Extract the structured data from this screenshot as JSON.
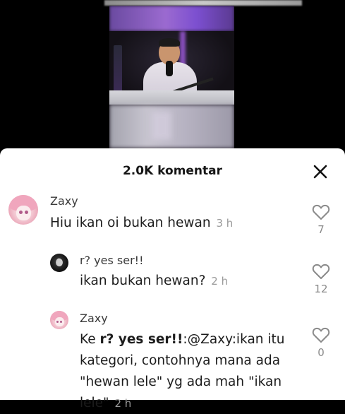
{
  "sheet": {
    "title": "2.0K komentar"
  },
  "comments": [
    {
      "username": "Zaxy",
      "avatar": "anime-girl-pink-hair",
      "text": "Hiu ikan oi bukan hewan",
      "time": "3 h",
      "likes": "7"
    },
    {
      "username": "r? yes ser!!",
      "avatar": "dark-splash",
      "text": "ikan bukan hewan?",
      "time": "2 h",
      "likes": "12"
    },
    {
      "username": "Zaxy",
      "avatar": "anime-girl-pink-hair",
      "reply_prefix": "Ke",
      "reply_to": "r? yes ser!!",
      "text_line1_rest": ":@Zaxy:ikan itu",
      "text_line2": "kategori, contohnya mana ada",
      "text_line3": "\"hewan lele\" yg ada mah \"ikan",
      "text_line4": "lele\"",
      "time": "2 h",
      "likes": "0"
    }
  ],
  "icons": {
    "close": "close-icon",
    "like": "heart-outline-icon"
  }
}
